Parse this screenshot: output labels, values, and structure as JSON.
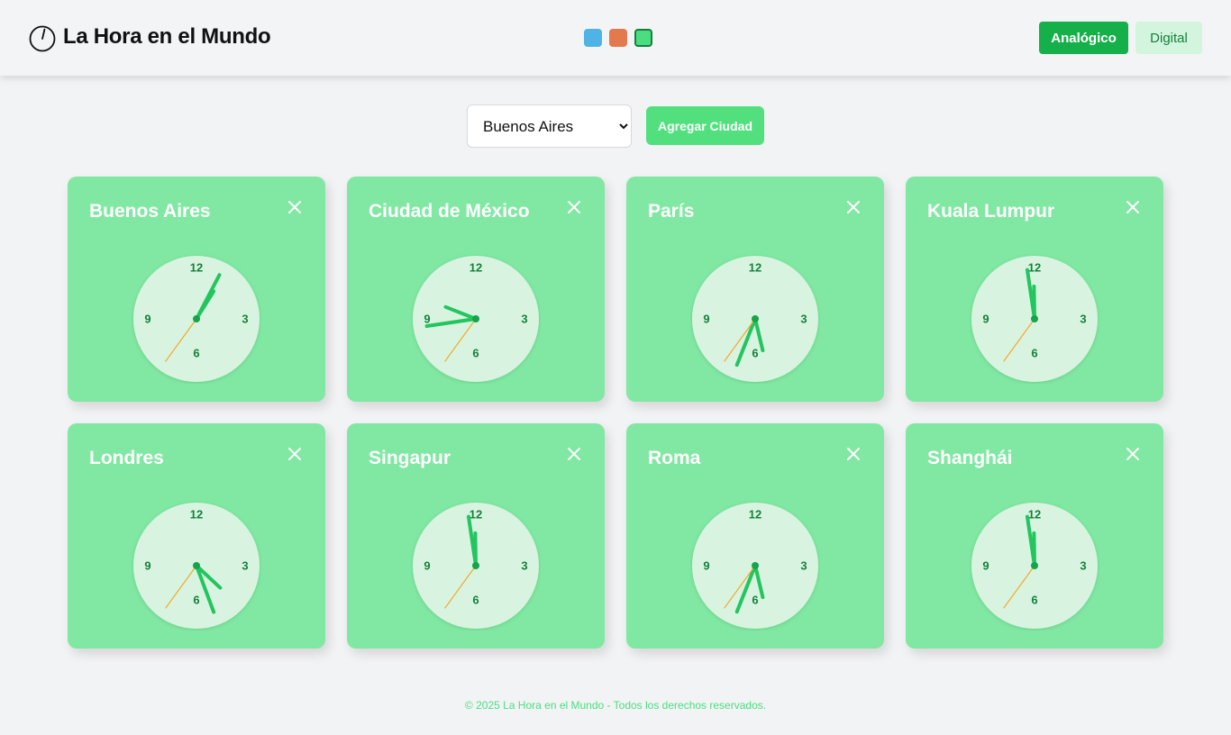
{
  "header": {
    "logo_icon": "clock-icon",
    "title": "La Hora en el Mundo",
    "themes": [
      {
        "name": "blue",
        "color": "#4fb3e6"
      },
      {
        "name": "orange",
        "color": "#e27a4e"
      },
      {
        "name": "green",
        "color": "#4ade80",
        "active": true
      }
    ],
    "analog_label": "Analógico",
    "digital_label": "Digital"
  },
  "controls": {
    "selected_city": "Buenos Aires",
    "add_label": "Agregar Ciudad"
  },
  "colors": {
    "primary": "#16b04a",
    "card_bg": "#80e8a2",
    "add_button": "#52e07f",
    "digital_button_bg": "#d4f5dd",
    "clock_face": "#d8f4e0",
    "hand": "#22c55e",
    "numeral": "#15803d",
    "center_dot": "#16a34a",
    "footer_text": "#4ade80"
  },
  "cities": [
    {
      "name": "Buenos Aires",
      "hour": 1,
      "minute": 4,
      "second": 36
    },
    {
      "name": "Ciudad de México",
      "hour": 9,
      "minute": 43,
      "second": 36
    },
    {
      "name": "París",
      "hour": 5,
      "minute": 33,
      "second": 36
    },
    {
      "name": "Kuala Lumpur",
      "hour": 11,
      "minute": 58,
      "second": 36
    },
    {
      "name": "Londres",
      "hour": 4,
      "minute": 26,
      "second": 36
    },
    {
      "name": "Singapur",
      "hour": 11,
      "minute": 58,
      "second": 36
    },
    {
      "name": "Roma",
      "hour": 5,
      "minute": 33,
      "second": 36
    },
    {
      "name": "Shanghái",
      "hour": 11,
      "minute": 58,
      "second": 36
    }
  ],
  "clock_numerals": [
    "12",
    "3",
    "6",
    "9"
  ],
  "footer": {
    "text": "© 2025 La Hora en el Mundo - Todos los derechos reservados."
  }
}
